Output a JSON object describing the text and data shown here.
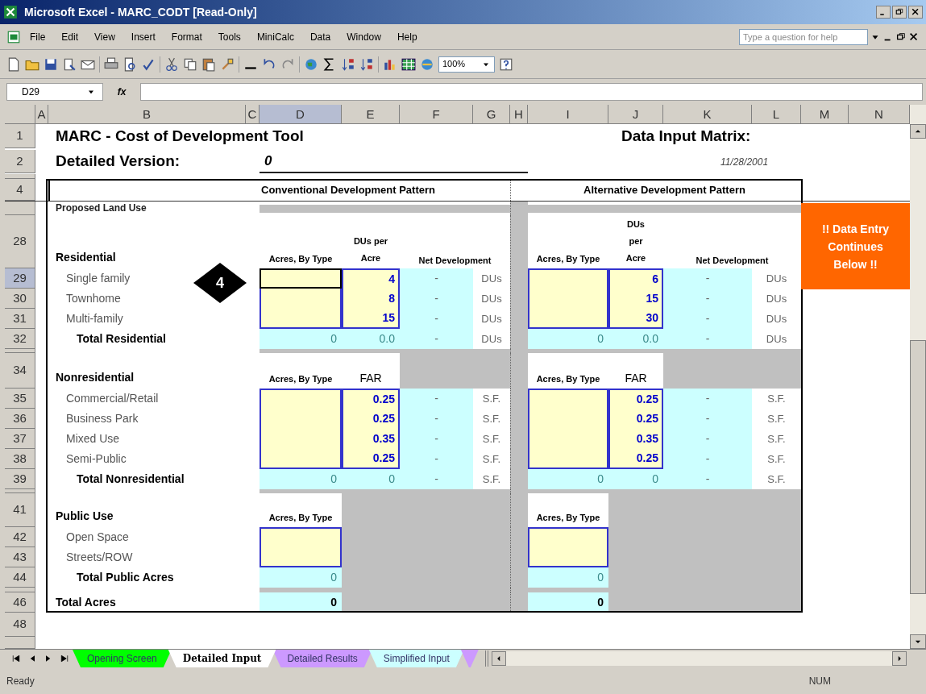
{
  "window": {
    "title": "Microsoft Excel - MARC_CODT [Read-Only]"
  },
  "menu": [
    "File",
    "Edit",
    "View",
    "Insert",
    "Format",
    "Tools",
    "MiniCalc",
    "Data",
    "Window",
    "Help"
  ],
  "help_box": {
    "placeholder": "Type a question for help"
  },
  "toolbar": {
    "zoom": "100%"
  },
  "formula_bar": {
    "name_box": "D29",
    "function_label": "fx"
  },
  "columns": [
    {
      "label": "A",
      "selected": false
    },
    {
      "label": "B",
      "selected": false
    },
    {
      "label": "C",
      "selected": false
    },
    {
      "label": "D",
      "selected": true
    },
    {
      "label": "E",
      "selected": false
    },
    {
      "label": "F",
      "selected": false
    },
    {
      "label": "G",
      "selected": false
    },
    {
      "label": "H",
      "selected": false
    },
    {
      "label": "I",
      "selected": false
    },
    {
      "label": "J",
      "selected": false
    },
    {
      "label": "K",
      "selected": false
    },
    {
      "label": "L",
      "selected": false
    },
    {
      "label": "M",
      "selected": false
    },
    {
      "label": "N",
      "selected": false
    }
  ],
  "rows": [
    {
      "kind": "title",
      "row": "1",
      "selected": false,
      "text": "MARC - Cost of Development Tool",
      "right_text": "Data Input Matrix:"
    },
    {
      "kind": "version",
      "row": "2",
      "selected": false,
      "label": "Detailed Version:",
      "value": "0",
      "date": "11/28/2001"
    },
    {
      "kind": "headings",
      "row": "4",
      "selected": false,
      "headings": [
        "Conventional Development Pattern",
        "Alternative Development Pattern"
      ]
    },
    {
      "kind": "caption",
      "text": "Proposed Land Use"
    },
    {
      "kind": "section",
      "row": "28",
      "selected": false,
      "label": "Residential",
      "headers": [
        {
          "acres": "Acres, By Type",
          "rate": "DUs per Acre",
          "net": "Net Development"
        },
        {
          "acres": "Acres, By Type",
          "rate": "DUs per Acre",
          "net": "Net Development"
        }
      ]
    },
    {
      "kind": "input",
      "row": "29",
      "selected": true,
      "label": "Single family",
      "values": [
        {
          "rate": "4",
          "net": "-",
          "unit": "DUs"
        },
        {
          "rate": "6",
          "net": "-",
          "unit": "DUs"
        }
      ]
    },
    {
      "kind": "input",
      "row": "30",
      "selected": false,
      "label": "Townhome",
      "values": [
        {
          "rate": "8",
          "net": "-",
          "unit": "DUs"
        },
        {
          "rate": "15",
          "net": "-",
          "unit": "DUs"
        }
      ]
    },
    {
      "kind": "input",
      "row": "31",
      "selected": false,
      "label": "Multi-family",
      "values": [
        {
          "rate": "15",
          "net": "-",
          "unit": "DUs"
        },
        {
          "rate": "30",
          "net": "-",
          "unit": "DUs"
        }
      ]
    },
    {
      "kind": "total",
      "row": "32",
      "selected": false,
      "label": "Total Residential",
      "values": [
        {
          "acres": "0",
          "rate": "0.0",
          "net": "-",
          "unit": "DUs"
        },
        {
          "acres": "0",
          "rate": "0.0",
          "net": "-",
          "unit": "DUs"
        }
      ]
    },
    {
      "kind": "section",
      "row": "34",
      "selected": false,
      "label": "Nonresidential",
      "headers": [
        {
          "acres": "Acres, By Type",
          "rate": "FAR"
        },
        {
          "acres": "Acres, By Type",
          "rate": "FAR"
        }
      ]
    },
    {
      "kind": "input",
      "row": "35",
      "selected": false,
      "label": "Commercial/Retail",
      "values": [
        {
          "rate": "0.25",
          "net": "-",
          "unit": "S.F."
        },
        {
          "rate": "0.25",
          "net": "-",
          "unit": "S.F."
        }
      ]
    },
    {
      "kind": "input",
      "row": "36",
      "selected": false,
      "label": "Business Park",
      "values": [
        {
          "rate": "0.25",
          "net": "-",
          "unit": "S.F."
        },
        {
          "rate": "0.25",
          "net": "-",
          "unit": "S.F."
        }
      ]
    },
    {
      "kind": "input",
      "row": "37",
      "selected": false,
      "label": "Mixed Use",
      "values": [
        {
          "rate": "0.35",
          "net": "-",
          "unit": "S.F."
        },
        {
          "rate": "0.35",
          "net": "-",
          "unit": "S.F."
        }
      ]
    },
    {
      "kind": "input",
      "row": "38",
      "selected": false,
      "label": "Semi-Public",
      "values": [
        {
          "rate": "0.25",
          "net": "-",
          "unit": "S.F."
        },
        {
          "rate": "0.25",
          "net": "-",
          "unit": "S.F."
        }
      ]
    },
    {
      "kind": "total",
      "row": "39",
      "selected": false,
      "label": "Total Nonresidential",
      "values": [
        {
          "acres": "0",
          "rate": "0",
          "net": "-",
          "unit": "S.F."
        },
        {
          "acres": "0",
          "rate": "0",
          "net": "-",
          "unit": "S.F."
        }
      ]
    },
    {
      "kind": "section",
      "row": "41",
      "selected": false,
      "label": "Public Use",
      "headers": [
        {
          "acres": "Acres, By Type"
        },
        {
          "acres": "Acres, By Type"
        }
      ]
    },
    {
      "kind": "input",
      "row": "42",
      "selected": false,
      "label": "Open Space"
    },
    {
      "kind": "input",
      "row": "43",
      "selected": false,
      "label": "Streets/ROW"
    },
    {
      "kind": "total",
      "row": "44",
      "selected": false,
      "label": "Total Public Acres",
      "values": [
        {
          "acres": "0"
        },
        {
          "acres": "0"
        }
      ]
    },
    {
      "kind": "grand_total",
      "row": "46",
      "selected": false,
      "label": "Total Acres",
      "values": [
        {
          "acres": "0"
        },
        {
          "acres": "0"
        }
      ]
    },
    {
      "kind": "blank",
      "row": "48",
      "selected": false
    }
  ],
  "step_badge": "4",
  "note": "!! Data Entry Continues Below !!",
  "sheet_tabs": [
    {
      "label": "Opening Screen",
      "selected": false,
      "color": "#00ff00"
    },
    {
      "label": "Detailed Input",
      "selected": true,
      "color": "#ffffff"
    },
    {
      "label": "Detailed Results",
      "selected": false,
      "color": "#cc99ff"
    },
    {
      "label": "Simplified Input",
      "selected": false,
      "color": "#ccffff"
    },
    {
      "selected": false,
      "color": "#cc99ff"
    }
  ],
  "status_bar": {
    "mode": "Ready",
    "indicator": "NUM"
  }
}
